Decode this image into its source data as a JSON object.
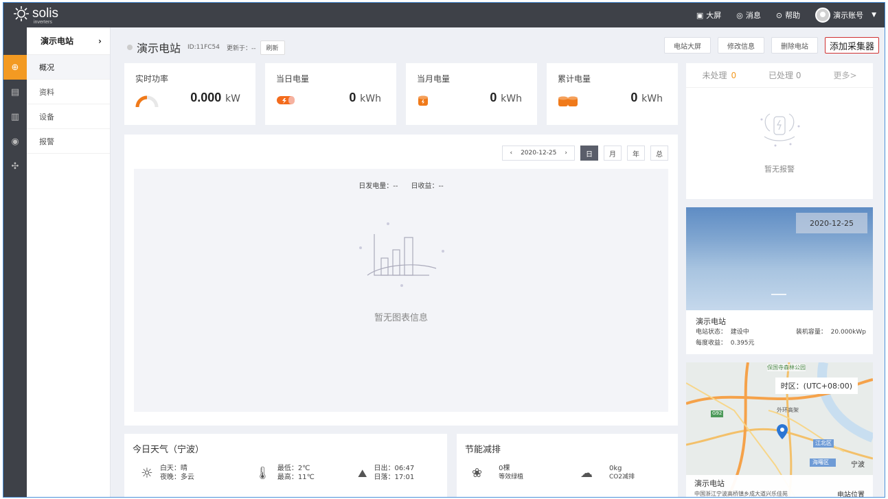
{
  "topbar": {
    "logo_text": "solis",
    "logo_sub": "inverters",
    "big_screen": "大屏",
    "messages": "消息",
    "help": "帮助",
    "account": "演示账号"
  },
  "sidebar": {
    "header": "演示电站",
    "items": [
      {
        "label": "概况"
      },
      {
        "label": "资料"
      },
      {
        "label": "设备"
      },
      {
        "label": "报警"
      }
    ]
  },
  "station": {
    "name": "演示电站",
    "id": "ID:11FC54",
    "updated": "更新于：--",
    "refresh": "刷新"
  },
  "actions": {
    "screen": "电站大屏",
    "edit": "修改信息",
    "delete": "删除电站",
    "add": "添加采集器"
  },
  "kpis": [
    {
      "label": "实时功率",
      "value": "0.000",
      "unit": "kW",
      "icon": "gauge-icon"
    },
    {
      "label": "当日电量",
      "value": "0",
      "unit": "kWh",
      "icon": "battery-icon"
    },
    {
      "label": "当月电量",
      "value": "0",
      "unit": "kWh",
      "icon": "cylinder-icon"
    },
    {
      "label": "累计电量",
      "value": "0",
      "unit": "kWh",
      "icon": "cylinders-icon"
    }
  ],
  "chart": {
    "date": "2020-12-25",
    "day": "日",
    "month": "月",
    "year": "年",
    "total": "总",
    "gen": "日发电量：--",
    "income": "日收益：--",
    "no_data": "暂无图表信息"
  },
  "alarms": {
    "unprocessed": "未处理",
    "unprocessed_count": "0",
    "processed": "已处理",
    "processed_count": "0",
    "more": "更多>",
    "none": "暂无报警"
  },
  "weather": {
    "title": "今日天气（宁波）",
    "day": "白天：晴",
    "night": "夜晚：多云",
    "low": "最低：2℃",
    "high": "最高：11℃",
    "sunrise": "日出：06:47",
    "sunset": "日落：17:01"
  },
  "eco": {
    "title": "节能减排",
    "trees": "0棵",
    "trees_label": "等效绿植",
    "co2": "0kg",
    "co2_label": "CO2减排"
  },
  "photo_card": {
    "date": "2020-12-25",
    "name": "演示电站",
    "status_label": "电站状态：",
    "status": "建设中",
    "cap_label": "装机容量：",
    "cap": "20.000kWp",
    "income_label": "每度收益：",
    "income": "0.395元"
  },
  "map": {
    "timezone": "时区：(UTC+08:00)",
    "name": "演示电站",
    "address": "中国浙江宁波高桥镇乡成大道兴乐佳苑",
    "location": "电站位置",
    "labels": [
      "保国寺森林公园",
      "江北区",
      "海曙区",
      "宁波",
      "外环高架",
      "G92"
    ]
  }
}
